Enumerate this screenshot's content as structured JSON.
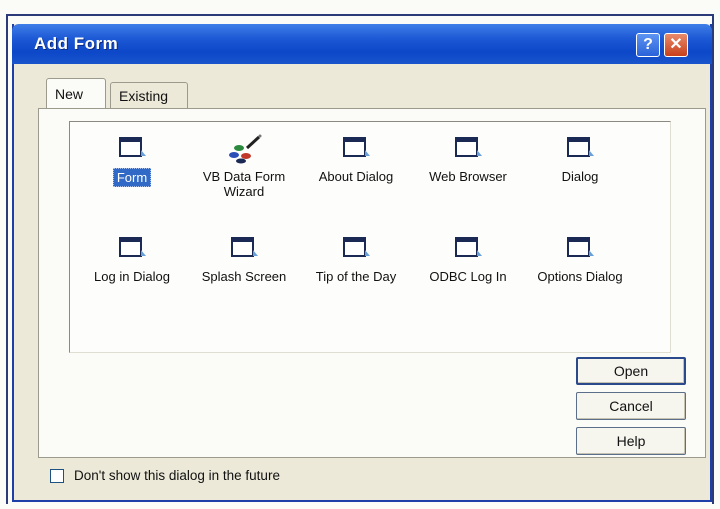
{
  "window": {
    "title": "Add Form",
    "help_button": "?",
    "close_button": "✕"
  },
  "tabs": [
    {
      "label": "New",
      "active": true
    },
    {
      "label": "Existing",
      "active": false
    }
  ],
  "items": [
    {
      "label": "Form",
      "icon": "form-icon",
      "selected": true
    },
    {
      "label": "VB Data Form Wizard",
      "icon": "wizard-icon",
      "selected": false
    },
    {
      "label": "About Dialog",
      "icon": "form-icon",
      "selected": false
    },
    {
      "label": "Web Browser",
      "icon": "form-icon",
      "selected": false
    },
    {
      "label": "Dialog",
      "icon": "form-icon",
      "selected": false
    },
    {
      "label": "Log in Dialog",
      "icon": "form-icon",
      "selected": false
    },
    {
      "label": "Splash Screen",
      "icon": "form-icon",
      "selected": false
    },
    {
      "label": "Tip of the Day",
      "icon": "form-icon",
      "selected": false
    },
    {
      "label": "ODBC Log In",
      "icon": "form-icon",
      "selected": false
    },
    {
      "label": "Options Dialog",
      "icon": "form-icon",
      "selected": false
    }
  ],
  "buttons": {
    "open": "Open",
    "cancel": "Cancel",
    "help": "Help"
  },
  "checkbox": {
    "label": "Don't show this dialog in the future",
    "checked": false
  },
  "colors": {
    "titlebar": "#0b47c8",
    "selection": "#3169c6",
    "window_bg": "#ece9d8"
  }
}
